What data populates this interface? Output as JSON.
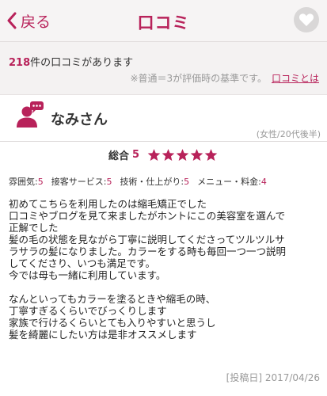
{
  "header": {
    "back_label": "戻る",
    "title": "口コミ",
    "brand_color": "#b8225a"
  },
  "summary": {
    "count": "218",
    "count_suffix": "件の口コミがあります",
    "criteria_note": "※普通＝3が評価時の基準です。",
    "criteria_link": "口コミとは"
  },
  "review": {
    "reviewer_name": "なみさん",
    "reviewer_meta": "(女性/20代後半)",
    "overall_label": "総合",
    "overall_score": "5",
    "star_rating": 5,
    "star_max": 5,
    "sub_ratings": [
      {
        "label": "雰囲気:",
        "value": "5"
      },
      {
        "label": "接客サービス:",
        "value": "5"
      },
      {
        "label": "技術・仕上がり:",
        "value": "5"
      },
      {
        "label": "メニュー・料金:",
        "value": "4"
      }
    ],
    "paragraphs": [
      [
        "初めてこちらを利用したのは縮毛矯正でした",
        "口コミやブログを見て来ましたがホントにこの美容室を選んで",
        "正解でした",
        "髪の毛の状態を見ながら丁寧に説明してくださってツルツルサ",
        "ラサラの髪になりました。カラーをする時も毎回一つ一つ説明",
        "してくださり、いつも満足です。",
        "今では母も一緒に利用しています。"
      ],
      [
        "なんといってもカラーを塗るときや縮毛の時、",
        "丁寧すぎるくらいでびっくりします",
        "家族で行けるくらいとても入りやすいと思うし",
        "髪を綺麗にしたい方は是非オススメします"
      ]
    ],
    "post_date": "[投稿日] 2017/04/26"
  },
  "icons": {
    "back": "chevron-left-icon",
    "favorite": "heart-icon",
    "avatar": "user-comment-icon",
    "star": "star-icon"
  }
}
